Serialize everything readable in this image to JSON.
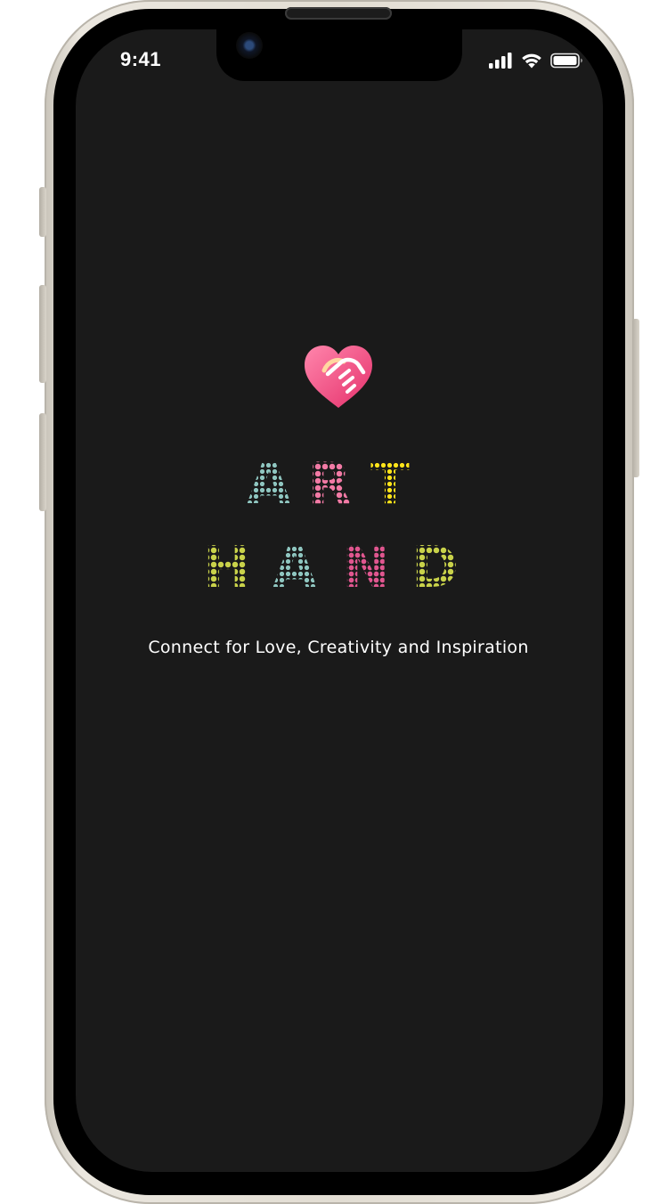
{
  "status_bar": {
    "time": "9:41",
    "icons": [
      "signal-icon",
      "wifi-icon",
      "battery-icon"
    ]
  },
  "logo": {
    "icon": "heart-handshake-icon",
    "colors": [
      "#ff6f9c",
      "#e9326f"
    ]
  },
  "title": {
    "line1": [
      "A",
      "R",
      "T"
    ],
    "line2": [
      "H",
      "A",
      "N",
      "D"
    ]
  },
  "tagline": "Connect for Love, Creativity and Inspiration",
  "theme": {
    "background": "#1a1a1a",
    "text": "#ffffff"
  }
}
